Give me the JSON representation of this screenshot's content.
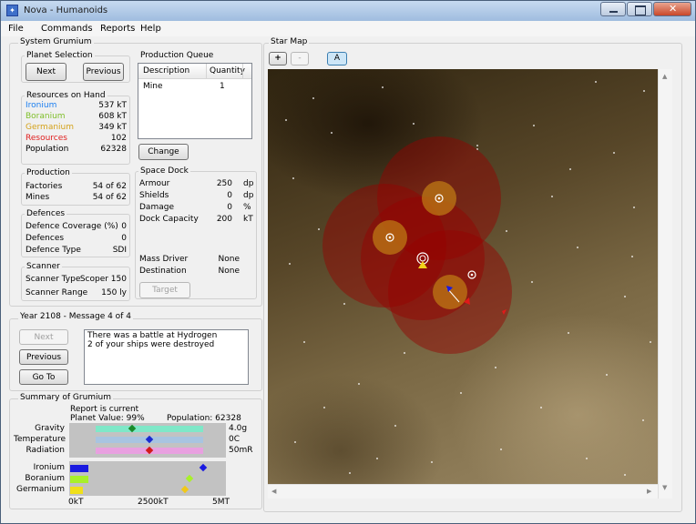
{
  "window": {
    "title": "Nova - Humanoids"
  },
  "menu": [
    "File",
    "Commands",
    "Reports",
    "Help"
  ],
  "system": {
    "group_title": "System Grumium",
    "planet_selection": {
      "title": "Planet Selection",
      "next": "Next",
      "previous": "Previous"
    },
    "resources": {
      "title": "Resources on Hand",
      "rows": [
        {
          "label": "Ironium",
          "value": "537 kT",
          "color": "#1a7ef0"
        },
        {
          "label": "Boranium",
          "value": "608 kT",
          "color": "#7fbf2a"
        },
        {
          "label": "Germanium",
          "value": "349 kT",
          "color": "#d4a21a"
        },
        {
          "label": "Resources",
          "value": "102",
          "color": "#e02020"
        },
        {
          "label": "Population",
          "value": "62328",
          "color": "#000000"
        }
      ]
    },
    "production": {
      "title": "Production",
      "factories_label": "Factories",
      "factories_value": "54 of 62",
      "mines_label": "Mines",
      "mines_value": "54 of 62"
    },
    "defences": {
      "title": "Defences",
      "coverage_label": "Defence Coverage (%)",
      "coverage_value": "0",
      "defences_label": "Defences",
      "defences_value": "0",
      "type_label": "Defence Type",
      "type_value": "SDI"
    },
    "scanner": {
      "title": "Scanner",
      "type_label": "Scanner Type",
      "type_value": "Scoper 150",
      "range_label": "Scanner Range",
      "range_value": "150 ly"
    },
    "queue": {
      "title": "Production Queue",
      "col_description": "Description",
      "col_quantity": "Quantity",
      "rows": [
        {
          "description": "Mine",
          "quantity": "1"
        }
      ],
      "change": "Change"
    },
    "dock": {
      "title": "Space Dock",
      "rows": [
        {
          "label": "Armour",
          "value": "250",
          "unit": "dp"
        },
        {
          "label": "Shields",
          "value": "0",
          "unit": "dp"
        },
        {
          "label": "Damage",
          "value": "0",
          "unit": "%"
        },
        {
          "label": "Dock Capacity",
          "value": "200",
          "unit": "kT"
        }
      ],
      "mass_driver_label": "Mass Driver",
      "mass_driver_value": "None",
      "destination_label": "Destination",
      "destination_value": "None",
      "target": "Target"
    }
  },
  "messages": {
    "group_title": "Year 2108 - Message 4 of 4",
    "next": "Next",
    "previous": "Previous",
    "goto": "Go To",
    "text_line1": "There was a battle at Hydrogen",
    "text_line2": "2 of your ships were destroyed"
  },
  "summary": {
    "group_title": "Summary of Grumium",
    "report_status": "Report is current",
    "planet_value": "Planet Value: 99%",
    "population": "Population: 62328",
    "environment": [
      {
        "label": "Gravity",
        "value": "4.0g",
        "bar_color": "#7fe8c8",
        "marker_color": "#1a8a2a",
        "marker_pos": 0.34
      },
      {
        "label": "Temperature",
        "value": "0C",
        "bar_color": "#a8c4e0",
        "marker_color": "#1a2ad0",
        "marker_pos": 0.5
      },
      {
        "label": "Radiation",
        "value": "50mR",
        "bar_color": "#e8a0e0",
        "marker_color": "#d01a1a",
        "marker_pos": 0.5
      }
    ],
    "minerals": [
      {
        "label": "Ironium",
        "bar_color": "#1a1ae0",
        "bar_frac": 0.12,
        "marker_color": "#1a1ae0",
        "marker_frac": 0.86
      },
      {
        "label": "Boranium",
        "bar_color": "#a8f02a",
        "bar_frac": 0.12,
        "marker_color": "#a8f02a",
        "marker_frac": 0.77
      },
      {
        "label": "Germanium",
        "bar_color": "#f0e01a",
        "bar_frac": 0.08,
        "marker_color": "#f0c81a",
        "marker_frac": 0.74
      }
    ],
    "axis": [
      "0kT",
      "2500kT",
      "5MT"
    ]
  },
  "star_map": {
    "group_title": "Star Map",
    "zoom_in": "+",
    "zoom_out": "-",
    "toggle": "A"
  }
}
